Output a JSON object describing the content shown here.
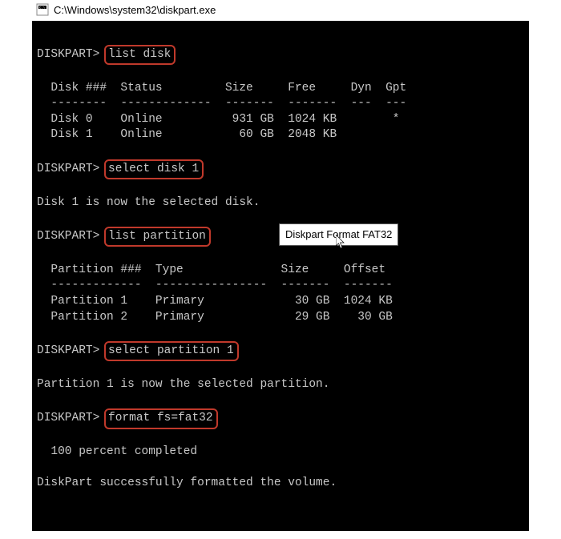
{
  "window": {
    "title_path": "C:\\Windows\\system32\\diskpart.exe"
  },
  "prompt": "DISKPART>",
  "commands": {
    "list_disk": "list disk",
    "select_disk": "select disk 1",
    "list_partition": "list partition",
    "select_partition": "select partition 1",
    "format": "format fs=fat32"
  },
  "messages": {
    "disk_selected": "Disk 1 is now the selected disk.",
    "partition_selected": "Partition 1 is now the selected partition.",
    "percent": "100 percent completed",
    "success": "DiskPart successfully formatted the volume."
  },
  "disk_table": {
    "header": "  Disk ###  Status         Size     Free     Dyn  Gpt",
    "divider": "  --------  -------------  -------  -------  ---  ---",
    "row0": "  Disk 0    Online          931 GB  1024 KB        *",
    "row1": "  Disk 1    Online           60 GB  2048 KB"
  },
  "part_table": {
    "header": "  Partition ###  Type              Size     Offset",
    "divider": "  -------------  ----------------  -------  -------",
    "row0": "  Partition 1    Primary             30 GB  1024 KB",
    "row1": "  Partition 2    Primary             29 GB    30 GB"
  },
  "tooltip": "Diskpart Format FAT32"
}
